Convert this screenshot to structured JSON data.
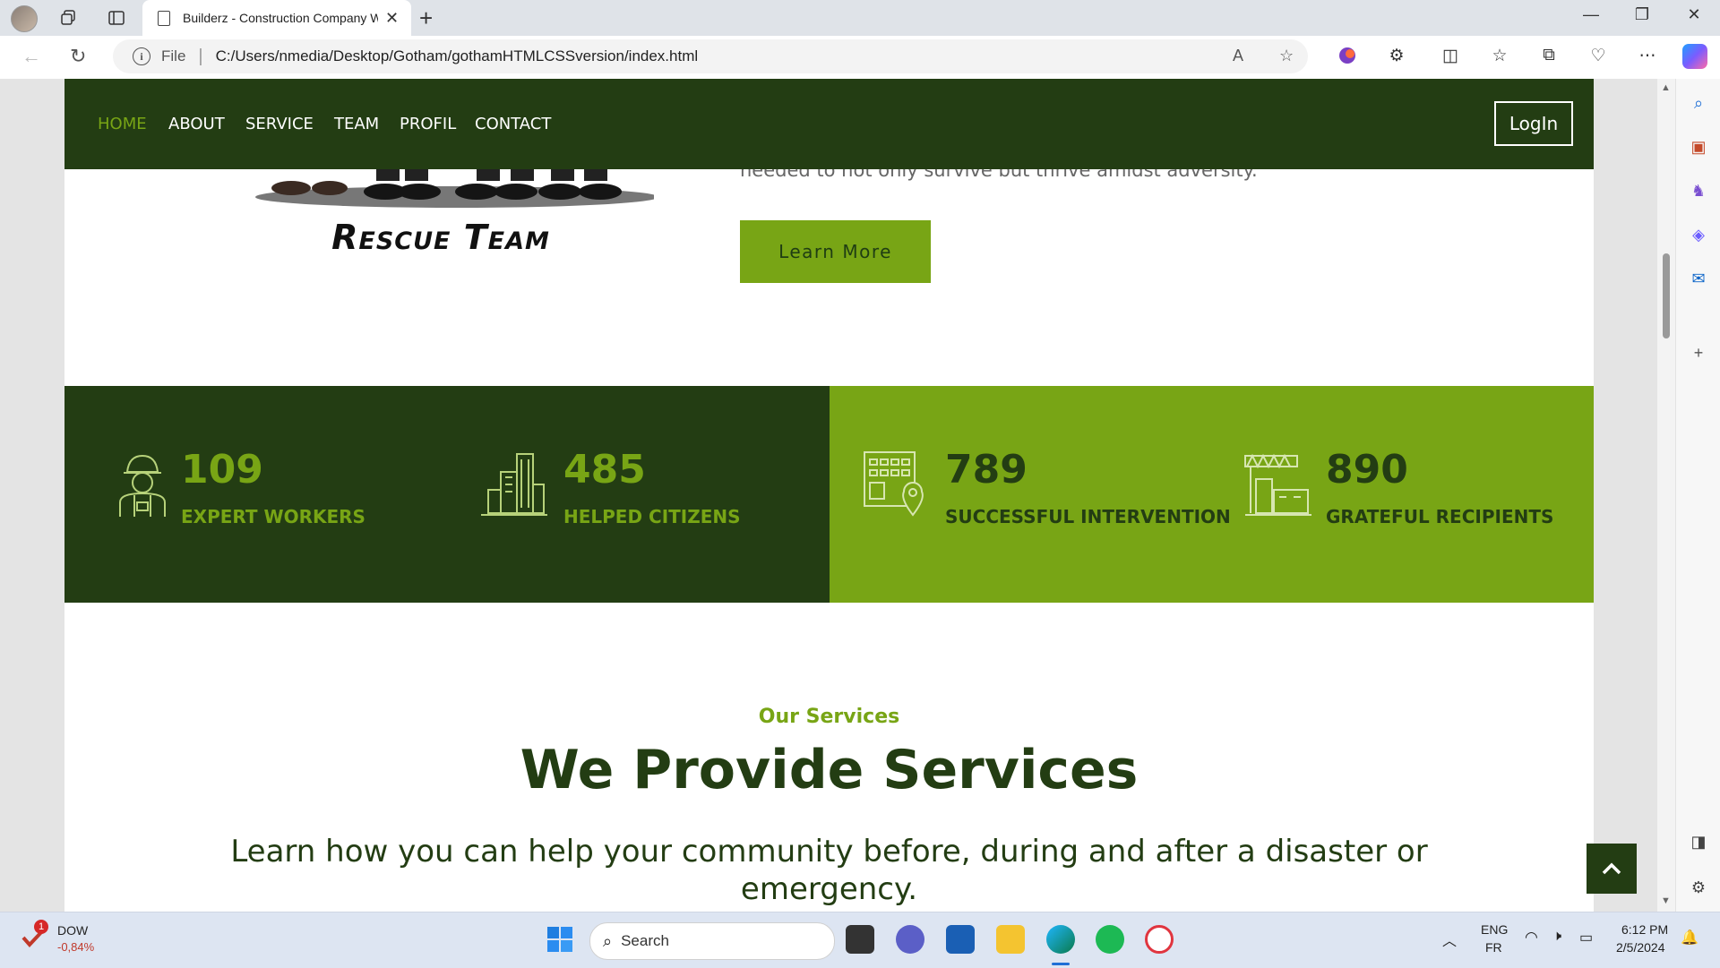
{
  "browser": {
    "tab_title": "Builderz - Construction Company Website Template",
    "new_tab_symbol": "+",
    "url_scheme": "File",
    "url": "C:/Users/nmedia/Desktop/Gotham/gothamHTMLCSSversion/index.html"
  },
  "nav": {
    "items": [
      "HOME",
      "ABOUT",
      "SERVICE",
      "TEAM",
      "PROFIL",
      "CONTACT"
    ],
    "active": "HOME",
    "login_label": "LogIn"
  },
  "hero": {
    "image_caption": "Rescue Team",
    "text_fragment": "needed to not only survive but thrive amidst adversity.",
    "button_label": "Learn More"
  },
  "stats": [
    {
      "number": "109",
      "label": "EXPERT WORKERS",
      "icon": "worker-icon"
    },
    {
      "number": "485",
      "label": "HELPED CITIZENS",
      "icon": "city-building-icon"
    },
    {
      "number": "789",
      "label": "SUCCESSFUL INTERVENTION",
      "icon": "building-location-icon"
    },
    {
      "number": "890",
      "label": "GRATEFUL RECIPIENTS",
      "icon": "construction-site-icon"
    }
  ],
  "services": {
    "eyebrow": "Our Services",
    "title": "We Provide Services",
    "text": "Learn how you can help your community before, during and after a disaster or emergency."
  },
  "taskbar": {
    "stock_name": "DOW",
    "stock_change": "-0,84%",
    "notification_count": "1",
    "search_label": "Search",
    "lang_top": "ENG",
    "lang_bottom": "FR",
    "time": "6:12 PM",
    "date": "2/5/2024"
  },
  "colors": {
    "dark_green": "#233d13",
    "accent_green": "#78a515"
  }
}
